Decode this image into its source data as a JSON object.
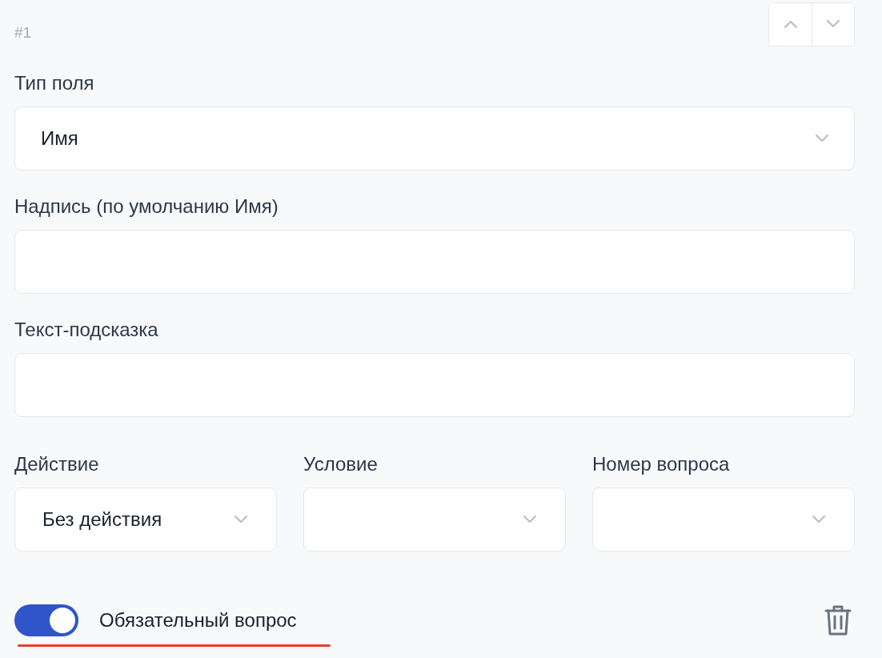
{
  "question": {
    "number": "#1",
    "fields": [
      {
        "kind": "select",
        "label": "Тип поля",
        "value": "Имя"
      },
      {
        "kind": "input",
        "label": "Надпись (по умолчанию Имя)"
      },
      {
        "kind": "input",
        "label": "Текст-подсказка"
      }
    ],
    "logic": [
      {
        "label": "Действие",
        "value": "Без действия"
      },
      {
        "label": "Условие"
      },
      {
        "label": "Номер вопроса"
      }
    ],
    "required_toggle": {
      "label": "Обязательный вопрос",
      "on": true,
      "underlined": true
    }
  }
}
